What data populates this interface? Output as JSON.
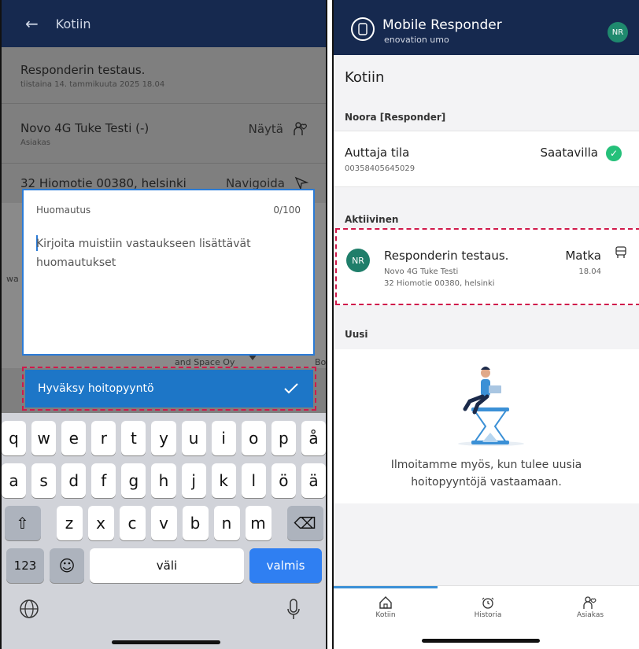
{
  "left": {
    "header": {
      "title": "Kotiin"
    },
    "rows": [
      {
        "title": "Responderin testaus.",
        "sub": "tiistaina 14. tammikuuta 2025 18.04"
      },
      {
        "title": "Novo 4G  Tuke Testi (-)",
        "sub": "Asiakas",
        "action": "Näytä"
      },
      {
        "title": "32 Hiomotie 00380, helsinki",
        "action": "Navigoida"
      }
    ],
    "map": {
      "label1": "and Space Oy",
      "label_left": "wa",
      "label_right": "Bo"
    },
    "note": {
      "label": "Huomautus",
      "counter": "0/100",
      "placeholder": "Kirjoita muistiin vastaukseen lisättävät huomautukset"
    },
    "accept_button": {
      "label": "Hyväksy hoitopyyntö"
    },
    "keyboard": {
      "row1": [
        "q",
        "w",
        "e",
        "r",
        "t",
        "y",
        "u",
        "i",
        "o",
        "p",
        "å"
      ],
      "row2": [
        "a",
        "s",
        "d",
        "f",
        "g",
        "h",
        "j",
        "k",
        "l",
        "ö",
        "ä"
      ],
      "row3": [
        "z",
        "x",
        "c",
        "v",
        "b",
        "n",
        "m"
      ],
      "numbers": "123",
      "space": "väli",
      "done": "valmis"
    }
  },
  "right": {
    "header": {
      "app_name": "Mobile Responder",
      "sub": "enovation umo",
      "avatar": "NR"
    },
    "page_title": "Kotiin",
    "user_section": "Noora [Responder]",
    "status": {
      "title": "Auttaja tila",
      "phone": "00358405645029",
      "value": "Saatavilla"
    },
    "active_section": "Aktiivinen",
    "active_item": {
      "avatar": "NR",
      "title": "Responderin testaus.",
      "line1": "Novo 4G  Tuke Testi",
      "line2": "32 Hiomotie 00380, helsinki",
      "mode": "Matka",
      "time": "18.04"
    },
    "new_section": "Uusi",
    "empty_message_1": "Ilmoitamme myös, kun tulee uusia",
    "empty_message_2": "hoitopyyntöjä vastaamaan.",
    "tabs": [
      {
        "label": "Kotiin",
        "icon": "home-icon"
      },
      {
        "label": "Historia",
        "icon": "clock-icon"
      },
      {
        "label": "Asiakas",
        "icon": "person-icon"
      }
    ]
  }
}
